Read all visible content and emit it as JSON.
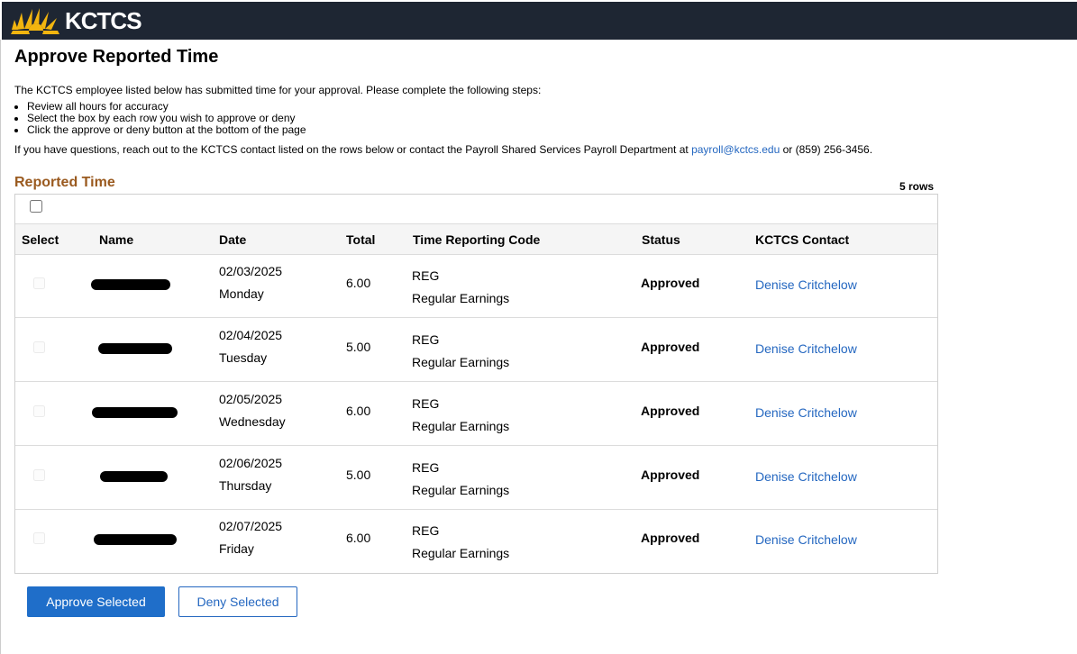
{
  "header": {
    "brand": "KCTCS"
  },
  "page": {
    "title": "Approve Reported Time",
    "intro": "The KCTCS employee listed below has submitted time for your approval. Please complete the following steps:",
    "steps": [
      "Review all hours for accuracy",
      "Select the box by each row you wish to approve or deny",
      "Click the approve or deny button at the bottom of the page"
    ],
    "contact_prefix": "If you have questions, reach out to the KCTCS contact listed on the rows below or contact the Payroll Shared Services Payroll Department at ",
    "contact_email": "payroll@kctcs.edu",
    "contact_suffix": " or (859) 256-3456."
  },
  "grid": {
    "title": "Reported Time",
    "row_count": "5 rows",
    "columns": [
      "Select",
      "Name",
      "Date",
      "Total",
      "Time Reporting Code",
      "Status",
      "KCTCS Contact"
    ],
    "rows": [
      {
        "date": "02/03/2025",
        "day": "Monday",
        "total": "6.00",
        "trc_code": "REG",
        "trc_desc": "Regular Earnings",
        "status": "Approved",
        "contact": "Denise Critchelow"
      },
      {
        "date": "02/04/2025",
        "day": "Tuesday",
        "total": "5.00",
        "trc_code": "REG",
        "trc_desc": "Regular Earnings",
        "status": "Approved",
        "contact": "Denise Critchelow"
      },
      {
        "date": "02/05/2025",
        "day": "Wednesday",
        "total": "6.00",
        "trc_code": "REG",
        "trc_desc": "Regular Earnings",
        "status": "Approved",
        "contact": "Denise Critchelow"
      },
      {
        "date": "02/06/2025",
        "day": "Thursday",
        "total": "5.00",
        "trc_code": "REG",
        "trc_desc": "Regular Earnings",
        "status": "Approved",
        "contact": "Denise Critchelow"
      },
      {
        "date": "02/07/2025",
        "day": "Friday",
        "total": "6.00",
        "trc_code": "REG",
        "trc_desc": "Regular Earnings",
        "status": "Approved",
        "contact": "Denise Critchelow"
      }
    ]
  },
  "actions": {
    "approve_label": "Approve Selected",
    "deny_label": "Deny Selected"
  },
  "colors": {
    "header_bg": "#1e2633",
    "section_title": "#9a5a1f",
    "link": "#2467c0",
    "primary_button": "#1f6ec9",
    "logo_sun": "#f2b50f"
  },
  "icons": {
    "logo": "sunburst-logo-icon"
  }
}
